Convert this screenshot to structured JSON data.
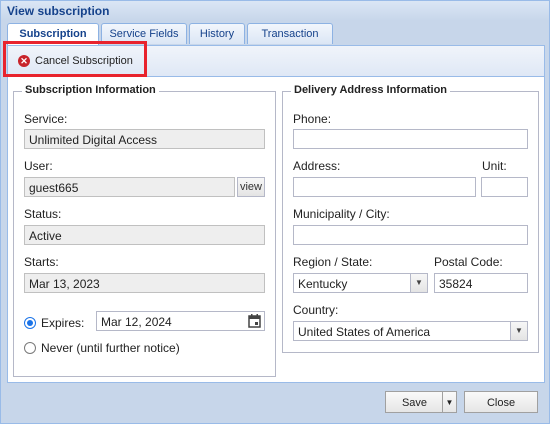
{
  "window": {
    "title": "View subscription"
  },
  "tabs": [
    {
      "label": "Subscription",
      "active": true
    },
    {
      "label": "Service Fields",
      "active": false
    },
    {
      "label": "History",
      "active": false
    },
    {
      "label": "Transaction",
      "active": false
    }
  ],
  "toolbar": {
    "cancel_label": "Cancel Subscription",
    "cancel_icon": "cancel-circle-icon"
  },
  "subscription": {
    "legend": "Subscription Information",
    "service_label": "Service:",
    "service_value": "Unlimited Digital Access",
    "user_label": "User:",
    "user_value": "guest665",
    "view_label": "view",
    "status_label": "Status:",
    "status_value": "Active",
    "starts_label": "Starts:",
    "starts_value": "Mar 13, 2023",
    "expires_label": "Expires:",
    "expires_value": "Mar 12, 2024",
    "expires_selected": true,
    "never_label": "Never (until further notice)"
  },
  "delivery": {
    "legend": "Delivery Address Information",
    "phone_label": "Phone:",
    "phone_value": "",
    "address_label": "Address:",
    "address_value": "",
    "unit_label": "Unit:",
    "unit_value": "",
    "city_label": "Municipality / City:",
    "city_value": "",
    "region_label": "Region / State:",
    "region_value": "Kentucky",
    "postal_label": "Postal Code:",
    "postal_value": "35824",
    "country_label": "Country:",
    "country_value": "United States of America"
  },
  "footer": {
    "save_label": "Save",
    "close_label": "Close"
  },
  "colors": {
    "accent": "#15428b",
    "highlight": "#e8232d",
    "cancel_icon": "#c8242b",
    "radio": "#1a73e8"
  }
}
